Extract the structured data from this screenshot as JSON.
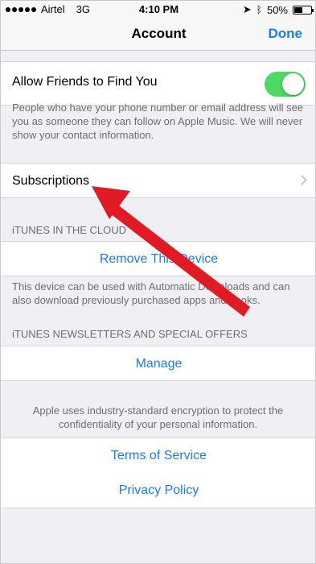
{
  "status_bar": {
    "carrier": "Airtel",
    "network": "3G",
    "time": "4:10 PM",
    "battery": "50%",
    "battery_level": 0.5
  },
  "nav": {
    "title": "Account",
    "done_label": "Done"
  },
  "allow_friends": {
    "label": "Allow Friends to Find You",
    "enabled": true,
    "footer": "People who have your phone number or email address will see you as someone they can follow on Apple Music. We will never show your contact information."
  },
  "subscriptions": {
    "label": "Subscriptions"
  },
  "itunes_cloud": {
    "header": "iTUNES IN THE CLOUD",
    "button_label": "Remove This Device",
    "footer": "This device can be used with Automatic Downloads and can also download previously purchased apps and books."
  },
  "newsletters": {
    "header": "iTUNES NEWSLETTERS AND SPECIAL OFFERS",
    "button_label": "Manage"
  },
  "privacy_note": "Apple uses industry-standard encryption to protect the confidentiality of your personal information.",
  "legal": {
    "terms_label": "Terms of Service",
    "privacy_label": "Privacy Policy"
  },
  "colors": {
    "accent": "#1a7cf5",
    "toggle_on": "#4cd964",
    "annotation_arrow": "#e01b24"
  }
}
